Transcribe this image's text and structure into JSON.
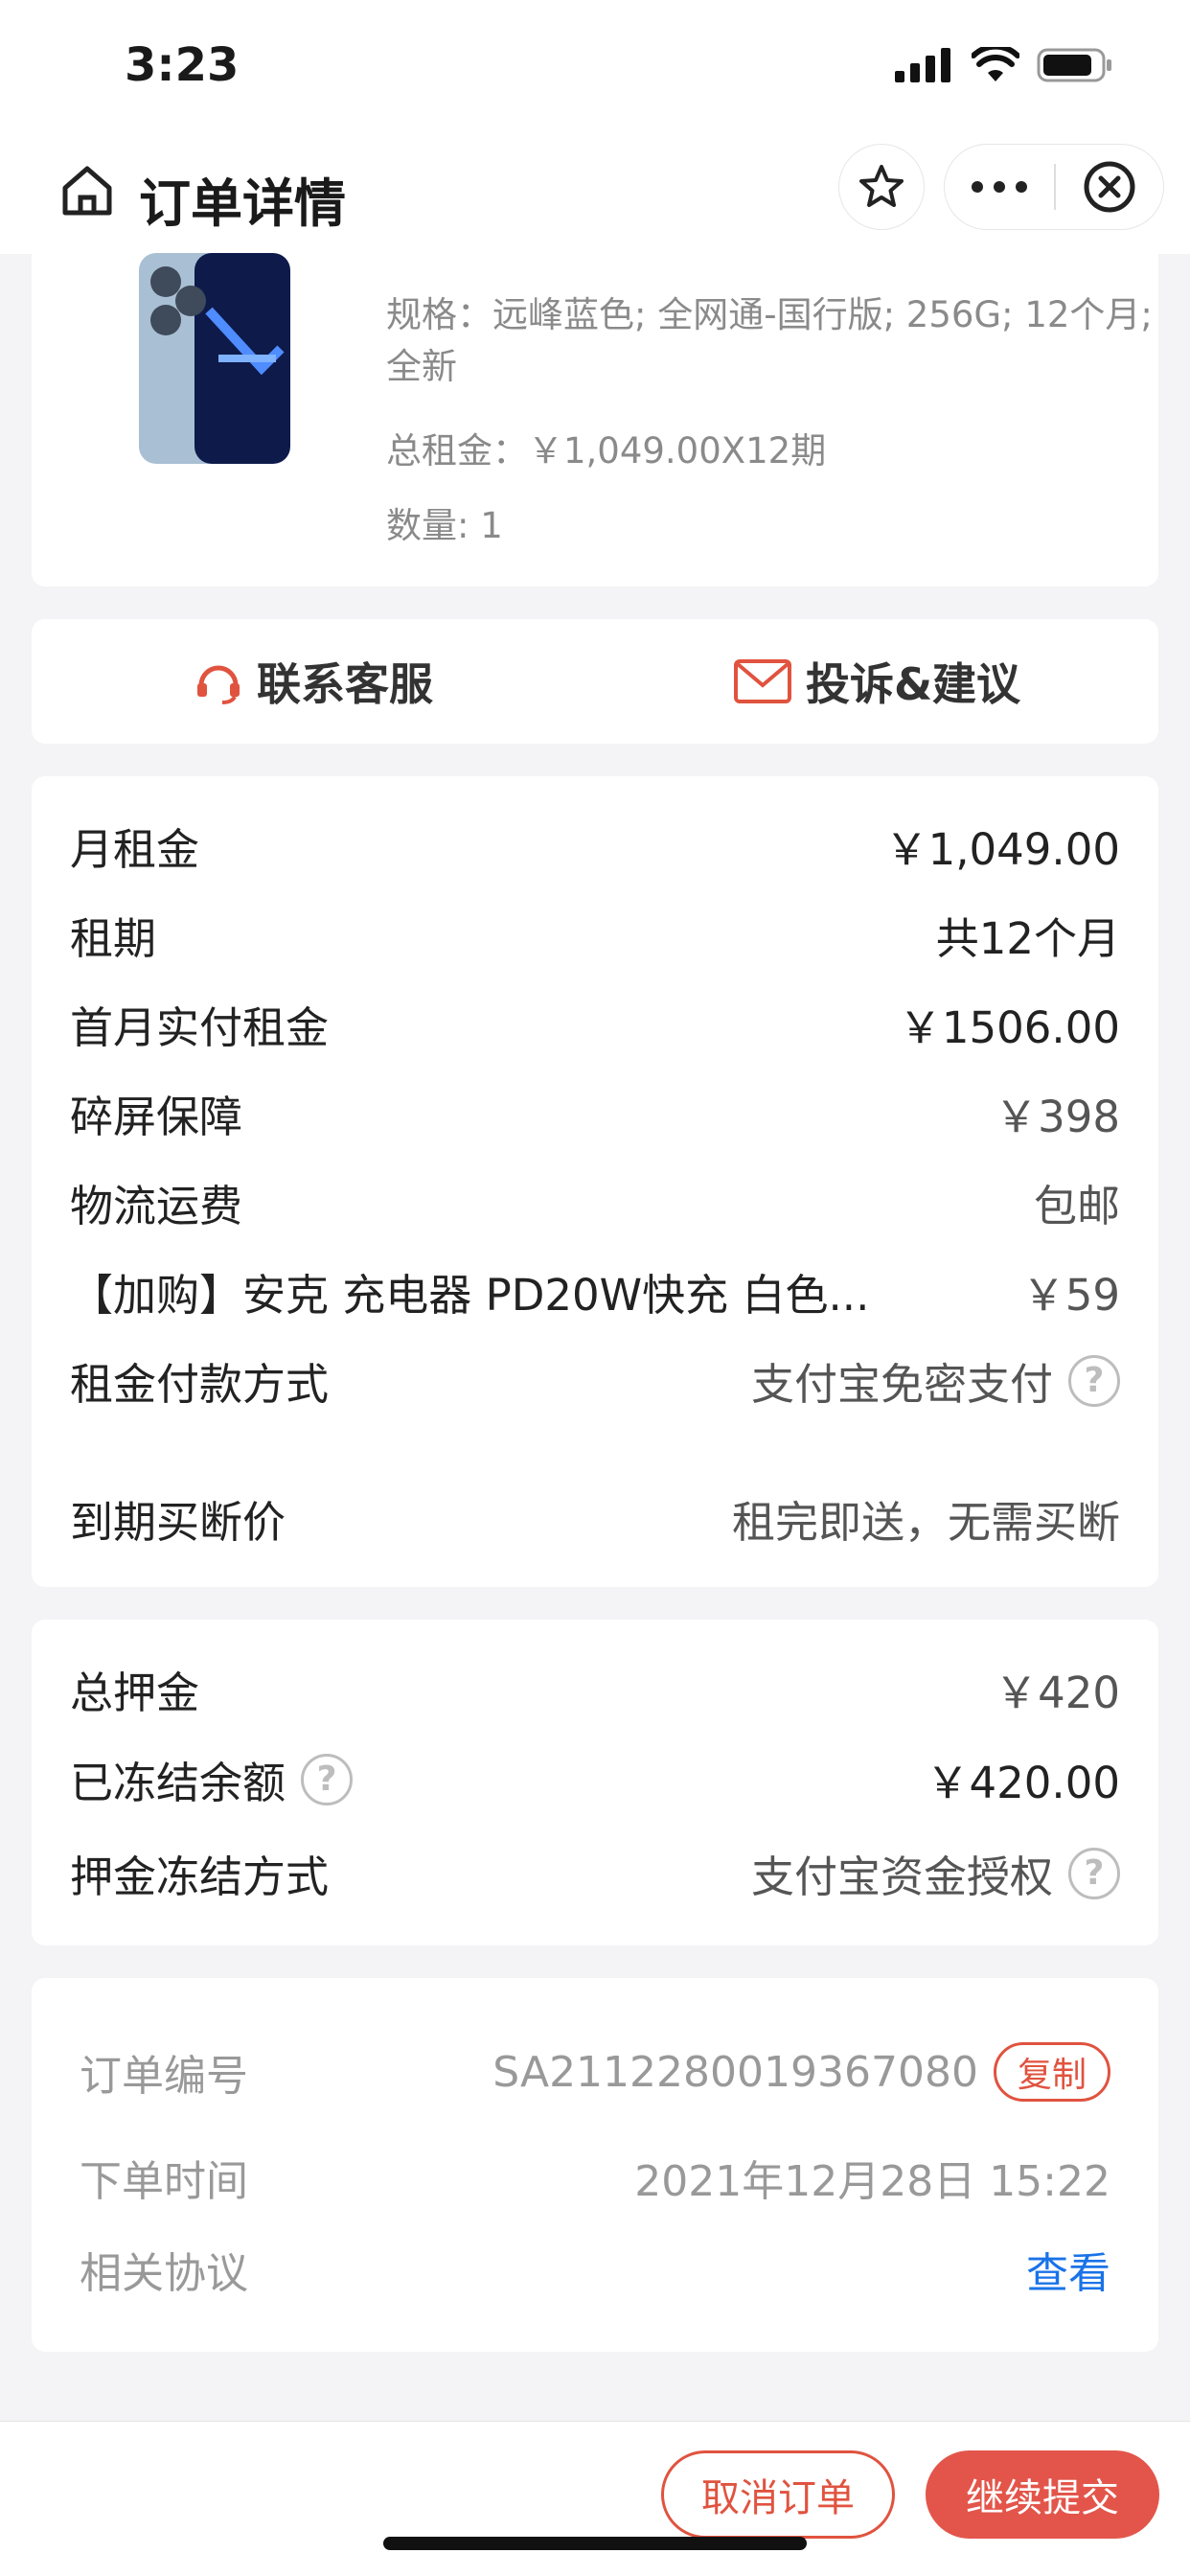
{
  "status_bar": {
    "time": "3:23"
  },
  "nav": {
    "title": "订单详情"
  },
  "product": {
    "spec": "规格：远峰蓝色; 全网通-国行版; 256G; 12个月; 全新",
    "total_rent": "总租金：￥1,049.00X12期",
    "quantity": "数量: 1"
  },
  "service": {
    "contact_label": "联系客服",
    "complaint_label": "投诉&建议"
  },
  "rent_details": [
    {
      "label": "月租金",
      "value": "￥1,049.00"
    },
    {
      "label": "租期",
      "value": "共12个月"
    },
    {
      "label": "首月实付租金",
      "value": "￥1506.00"
    },
    {
      "label": "碎屏保障",
      "value": "￥398"
    },
    {
      "label": "物流运费",
      "value": "包邮"
    },
    {
      "label": "【加购】安克 充电器 PD20W快充 白色...",
      "value": "￥59"
    },
    {
      "label": "租金付款方式",
      "value": "支付宝免密支付"
    },
    {
      "label": "到期买断价",
      "value": "租完即送，无需买断"
    }
  ],
  "deposit": [
    {
      "label": "总押金",
      "value": "￥420"
    },
    {
      "label": "已冻结余额",
      "value": "￥420.00"
    },
    {
      "label": "押金冻结方式",
      "value": "支付宝资金授权"
    }
  ],
  "order_info": {
    "order_no_label": "订单编号",
    "order_no": "SA2112280019367080",
    "copy_label": "复制",
    "time_label": "下单时间",
    "time": "2021年12月28日 15:22",
    "agreement_label": "相关协议",
    "agreement_link": "查看"
  },
  "actions": {
    "cancel_label": "取消订单",
    "submit_label": "继续提交"
  },
  "colors": {
    "accent": "#e3554a",
    "link": "#1a73e8"
  }
}
